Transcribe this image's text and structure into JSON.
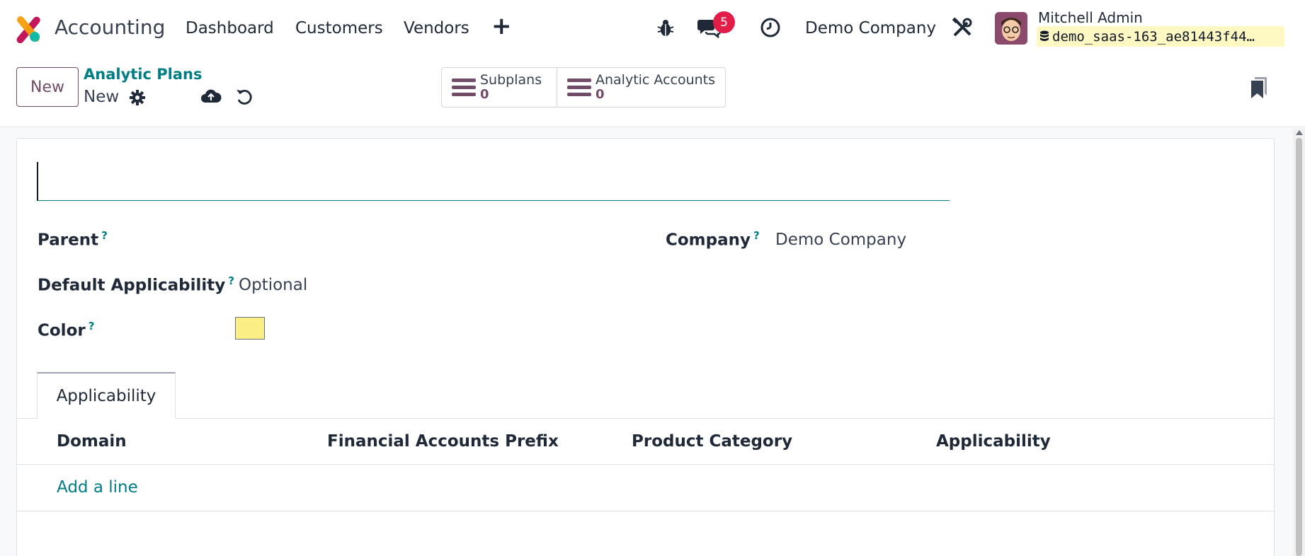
{
  "navbar": {
    "app_name": "Accounting",
    "menus": [
      "Dashboard",
      "Customers",
      "Vendors"
    ],
    "add_menu_icon": "plus-icon",
    "debug_icon": "bug-icon",
    "messages_icon": "chat-icon",
    "messages_count": "5",
    "activity_icon": "clock-icon",
    "company": "Demo Company",
    "settings_icon": "tools-icon",
    "user_name": "Mitchell Admin",
    "database": "demo_saas-163_ae81443f44…",
    "database_icon": "database-icon"
  },
  "control_panel": {
    "new_button": "New",
    "breadcrumb_parent": "Analytic Plans",
    "breadcrumb_current": "New",
    "gear_icon": "gear-icon",
    "save_icon": "cloud-upload-icon",
    "discard_icon": "undo-icon",
    "smart_buttons": [
      {
        "label": "Subplans",
        "value": "0",
        "icon": "list-icon"
      },
      {
        "label": "Analytic Accounts",
        "value": "0",
        "icon": "list-icon"
      }
    ],
    "bookmark_icon": "bookmark-icon"
  },
  "form": {
    "name_value": "",
    "fields": {
      "parent_label": "Parent",
      "parent_value": "",
      "company_label": "Company",
      "company_value": "Demo Company",
      "default_applicability_label": "Default Applicability",
      "default_applicability_value": "Optional",
      "color_label": "Color",
      "tooltip_mark": "?"
    },
    "color_value": "#fbee85",
    "tabs": [
      "Applicability"
    ],
    "table": {
      "columns": [
        "Domain",
        "Financial Accounts Prefix",
        "Product Category",
        "Applicability"
      ],
      "add_line": "Add a line"
    }
  },
  "colors": {
    "brand": "#714b67",
    "link": "#017e84",
    "badge": "#e11d48"
  }
}
